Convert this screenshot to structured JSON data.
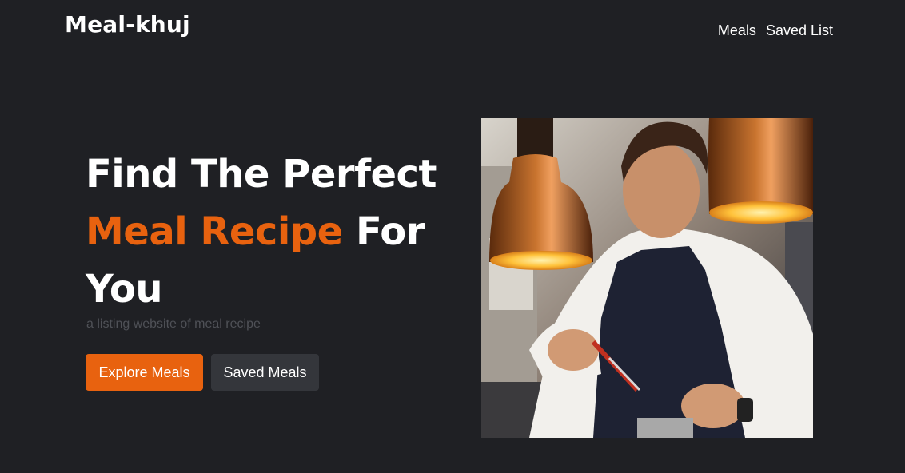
{
  "brand": {
    "logo": "Meal-khuj"
  },
  "nav": {
    "meals": "Meals",
    "saved_list": "Saved List"
  },
  "hero": {
    "title_line1": "Find The Perfect",
    "title_accent": "Meal Recipe",
    "title_after_accent": "For",
    "title_line3": "You",
    "subtitle": "a listing website of meal recipe",
    "explore_button": "Explore Meals",
    "saved_button": "Saved Meals",
    "image_icon": "chef-cooking-photo"
  },
  "colors": {
    "background": "#1f2024",
    "accent": "#e8620f",
    "secondary_button": "#34363b",
    "subtitle_text": "#4f5157"
  }
}
